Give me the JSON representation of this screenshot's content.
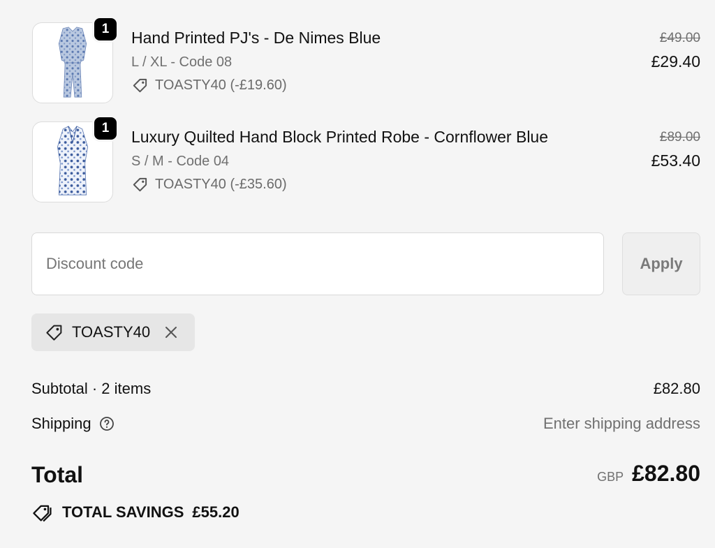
{
  "line_items": [
    {
      "quantity": "1",
      "title": "Hand Printed PJ's - De Nimes Blue",
      "variant": "L / XL - Code 08",
      "discount": "TOASTY40 (-£19.60)",
      "original_price": "£49.00",
      "price": "£29.40"
    },
    {
      "quantity": "1",
      "title": "Luxury Quilted Hand Block Printed Robe - Cornflower Blue",
      "variant": "S / M - Code 04",
      "discount": "TOASTY40 (-£35.60)",
      "original_price": "£89.00",
      "price": "£53.40"
    }
  ],
  "discount_form": {
    "placeholder": "Discount code",
    "apply_label": "Apply"
  },
  "applied_code": "TOASTY40",
  "summary": {
    "subtotal_label": "Subtotal · 2 items",
    "subtotal_value": "£82.80",
    "shipping_label": "Shipping",
    "shipping_value": "Enter shipping address",
    "total_label": "Total",
    "currency": "GBP",
    "total_value": "£82.80",
    "savings_label": "TOTAL SAVINGS",
    "savings_value": "£55.20"
  },
  "colors": {
    "background": "#f5f5f5",
    "fabric_blue": "#3a5a9c",
    "fabric_light": "#c9d6ea"
  },
  "icons": [
    "tag-icon",
    "close-icon",
    "help-circle-icon",
    "savings-tag-icon"
  ]
}
